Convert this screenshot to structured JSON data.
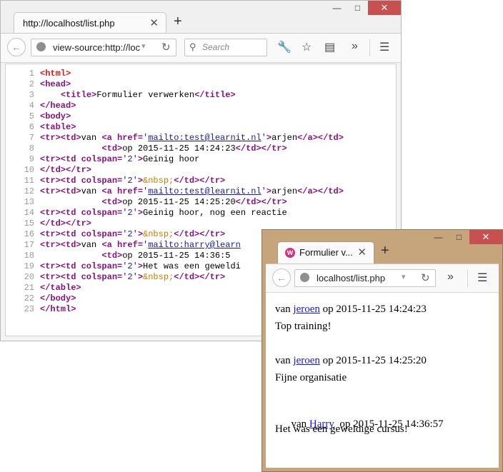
{
  "source_window": {
    "tab_title": "http://localhost/list.php",
    "url": "view-source:http://loc",
    "search_placeholder": "Search",
    "code_lines": [
      [
        {
          "t": "root",
          "v": "<html>"
        }
      ],
      [
        {
          "t": "tag",
          "v": "<head>"
        }
      ],
      [
        {
          "t": "txt",
          "v": "    "
        },
        {
          "t": "tag",
          "v": "<title>"
        },
        {
          "t": "txt",
          "v": "Formulier verwerken"
        },
        {
          "t": "tag",
          "v": "</title>"
        }
      ],
      [
        {
          "t": "tag",
          "v": "</head>"
        }
      ],
      [
        {
          "t": "tag",
          "v": "<body>"
        }
      ],
      [
        {
          "t": "tag",
          "v": "<table>"
        }
      ],
      [
        {
          "t": "tag",
          "v": "<tr><td>"
        },
        {
          "t": "txt",
          "v": "van "
        },
        {
          "t": "tag",
          "v": "<a href="
        },
        {
          "t": "attr",
          "v": "'"
        },
        {
          "t": "link",
          "v": "mailto:test@learnit.nl"
        },
        {
          "t": "attr",
          "v": "'"
        },
        {
          "t": "tag",
          "v": ">"
        },
        {
          "t": "txt",
          "v": "arjen"
        },
        {
          "t": "tag",
          "v": "</a></td>"
        }
      ],
      [
        {
          "t": "txt",
          "v": "            "
        },
        {
          "t": "tag",
          "v": "<td>"
        },
        {
          "t": "txt",
          "v": "op 2015-11-25 14:24:23"
        },
        {
          "t": "tag",
          "v": "</td></tr>"
        }
      ],
      [
        {
          "t": "tag",
          "v": "<tr><td colspan="
        },
        {
          "t": "attr",
          "v": "'2'"
        },
        {
          "t": "tag",
          "v": ">"
        },
        {
          "t": "txt",
          "v": "Geinig hoor"
        }
      ],
      [
        {
          "t": "tag",
          "v": "</td></tr>"
        }
      ],
      [
        {
          "t": "tag",
          "v": "<tr><td colspan="
        },
        {
          "t": "attr",
          "v": "'2'"
        },
        {
          "t": "tag",
          "v": ">"
        },
        {
          "t": "ent",
          "v": "&nbsp;"
        },
        {
          "t": "tag",
          "v": "</td></tr>"
        }
      ],
      [
        {
          "t": "tag",
          "v": "<tr><td>"
        },
        {
          "t": "txt",
          "v": "van "
        },
        {
          "t": "tag",
          "v": "<a href="
        },
        {
          "t": "attr",
          "v": "'"
        },
        {
          "t": "link",
          "v": "mailto:test@learnit.nl"
        },
        {
          "t": "attr",
          "v": "'"
        },
        {
          "t": "tag",
          "v": ">"
        },
        {
          "t": "txt",
          "v": "arjen"
        },
        {
          "t": "tag",
          "v": "</a></td>"
        }
      ],
      [
        {
          "t": "txt",
          "v": "            "
        },
        {
          "t": "tag",
          "v": "<td>"
        },
        {
          "t": "txt",
          "v": "op 2015-11-25 14:25:20"
        },
        {
          "t": "tag",
          "v": "</td></tr>"
        }
      ],
      [
        {
          "t": "tag",
          "v": "<tr><td colspan="
        },
        {
          "t": "attr",
          "v": "'2'"
        },
        {
          "t": "tag",
          "v": ">"
        },
        {
          "t": "txt",
          "v": "Geinig hoor, nog een reactie"
        }
      ],
      [
        {
          "t": "tag",
          "v": "</td></tr>"
        }
      ],
      [
        {
          "t": "tag",
          "v": "<tr><td colspan="
        },
        {
          "t": "attr",
          "v": "'2'"
        },
        {
          "t": "tag",
          "v": ">"
        },
        {
          "t": "ent",
          "v": "&nbsp;"
        },
        {
          "t": "tag",
          "v": "</td></tr>"
        }
      ],
      [
        {
          "t": "tag",
          "v": "<tr><td>"
        },
        {
          "t": "txt",
          "v": "van "
        },
        {
          "t": "tag",
          "v": "<a href="
        },
        {
          "t": "attr",
          "v": "'"
        },
        {
          "t": "link",
          "v": "mailto:harry@learn"
        }
      ],
      [
        {
          "t": "txt",
          "v": "            "
        },
        {
          "t": "tag",
          "v": "<td>"
        },
        {
          "t": "txt",
          "v": "op 2015-11-25 14:36:5"
        }
      ],
      [
        {
          "t": "tag",
          "v": "<tr><td colspan="
        },
        {
          "t": "attr",
          "v": "'2'"
        },
        {
          "t": "tag",
          "v": ">"
        },
        {
          "t": "txt",
          "v": "Het was een geweldi"
        }
      ],
      [
        {
          "t": "tag",
          "v": "<tr><td colspan="
        },
        {
          "t": "attr",
          "v": "'2'"
        },
        {
          "t": "tag",
          "v": ">"
        },
        {
          "t": "ent",
          "v": "&nbsp;"
        },
        {
          "t": "tag",
          "v": "</td></tr>"
        }
      ],
      [
        {
          "t": "tag",
          "v": "</table>"
        }
      ],
      [
        {
          "t": "tag",
          "v": "</body>"
        }
      ],
      [
        {
          "t": "tag",
          "v": "</html>"
        }
      ]
    ]
  },
  "render_window": {
    "tab_title": "Formulier v...",
    "url": "localhost/list.php",
    "entries": [
      {
        "prefix": "van ",
        "name": "jeroen",
        "date": " op 2015-11-25 14:24:23",
        "message": "Top training!"
      },
      {
        "prefix": "van ",
        "name": "jeroen",
        "date": " op 2015-11-25 14:25:20",
        "message": "Fijne organisatie"
      },
      {
        "prefix": "van ",
        "name": "Harry",
        "date": "  op 2015-11-25 14:36:57",
        "message": "Het was een geweldige cursus!"
      }
    ]
  },
  "icons": {
    "minimize": "—",
    "maximize": "□",
    "close": "✕",
    "new_tab": "+",
    "back": "←",
    "dropdown": "▾",
    "reload": "↻",
    "search": "⚲",
    "tools": "🔧",
    "bookmark": "☆",
    "reader": "▤",
    "overflow": "»",
    "menu": "☰",
    "tab_close": "✕"
  },
  "colors": {
    "close_button": "#c75050",
    "render_frame": "#c7a57c",
    "tag": "#881280",
    "attr_value": "#1a1aa6",
    "entity": "#ce7b00"
  }
}
